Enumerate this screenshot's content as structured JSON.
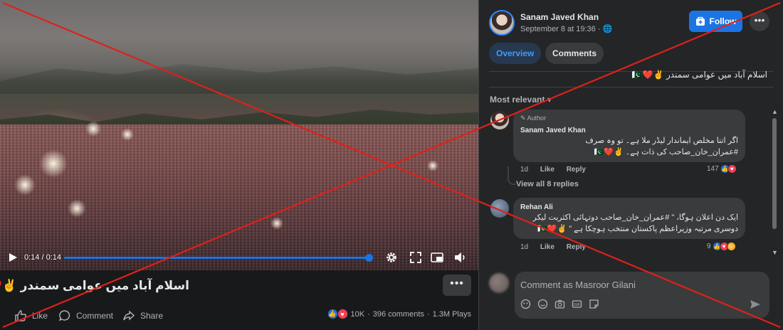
{
  "video": {
    "time": "0:14 / 0:14",
    "progress": 1.0,
    "caption": "اسلام آباد میں عوامی سمندر ✌️♥️PK",
    "more_label": "•••"
  },
  "actions": {
    "like": "Like",
    "comment": "Comment",
    "share": "Share"
  },
  "stats": {
    "reactions": "10K",
    "comments": "396 comments",
    "plays": "1.3M Plays",
    "separator": "·"
  },
  "post": {
    "author": "Sanam Javed Khan",
    "meta": "September 8 at 19:36 · 🌐",
    "follow_label": "Follow",
    "more_label": "•••",
    "text": "اسلام آباد میں عوامی سمندر ✌️❤️🇵🇰",
    "tabs": [
      {
        "label": "Overview",
        "active": true
      },
      {
        "label": "Comments",
        "active": false
      }
    ],
    "sort_label": "Most relevant ▾"
  },
  "comments": [
    {
      "badge": "✎ Author",
      "name": "Sanam Javed Khan",
      "lines": [
        "اگر اتنا مخلص ایماندار لیڈر ملا ہے۔ تو وہ صرف",
        "#عمران_خان_صاحب کی ذات ہے۔ ✌️❤️🇵🇰"
      ],
      "time": "1d",
      "like": "Like",
      "reply": "Reply",
      "reaction_count": "147"
    },
    {
      "badge": "",
      "name": "Rehan Ali",
      "lines": [
        "ایک دن اعلان ہوگا، \" #عمران_خان_صاحب دوتہائی اکثریت لیکر",
        "دوسری مرتبہ وزیراعظم پاکستان منتخب ہوچکا ہے \" ✌️❤️🇵🇰"
      ],
      "time": "1d",
      "like": "Like",
      "reply": "Reply",
      "reaction_count": "9"
    }
  ],
  "view_replies": "View all 8 replies",
  "composer": {
    "placeholder": "Comment as Masroor Gilani"
  },
  "colors": {
    "accent": "#1b74e4",
    "overlay_x": "#e0201a",
    "panel": "#242526"
  }
}
